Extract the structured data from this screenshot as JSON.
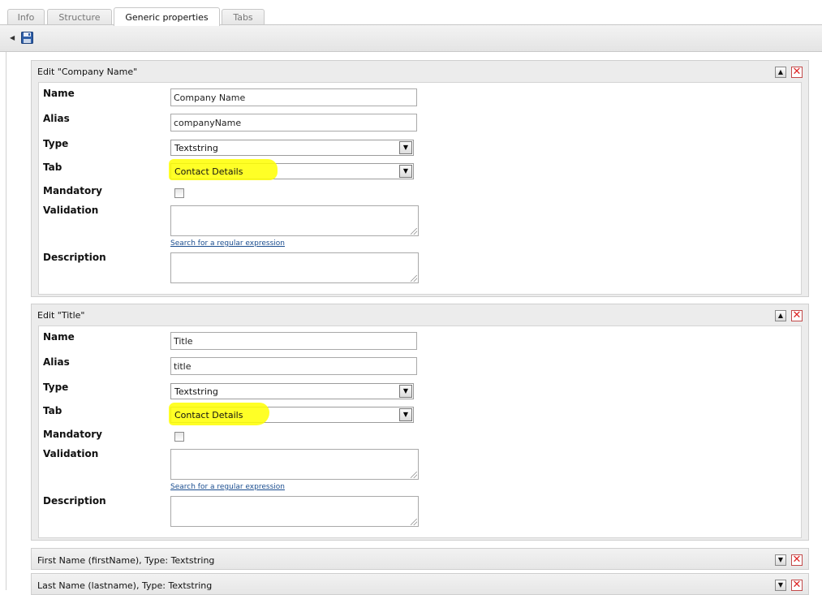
{
  "tabs": [
    {
      "label": "Info",
      "active": false
    },
    {
      "label": "Structure",
      "active": false
    },
    {
      "label": "Generic properties",
      "active": true
    },
    {
      "label": "Tabs",
      "active": false
    }
  ],
  "toolbar": {
    "collapse_icon": "triangle-left-icon",
    "save_icon": "floppy-disk-icon"
  },
  "labels": {
    "name": "Name",
    "alias": "Alias",
    "type": "Type",
    "tab": "Tab",
    "mandatory": "Mandatory",
    "validation": "Validation",
    "description": "Description",
    "regex_link": "Search for a regular expression"
  },
  "panels": [
    {
      "title": "Edit \"Company Name\"",
      "name": "Company Name",
      "alias": "companyName",
      "type": "Textstring",
      "tab": "Contact Details",
      "mandatory": false,
      "validation": "",
      "description": ""
    },
    {
      "title": "Edit \"Title\"",
      "name": "Title",
      "alias": "title",
      "type": "Textstring",
      "tab": "Contact Details",
      "mandatory": false,
      "validation": "",
      "description": ""
    }
  ],
  "collapsed": [
    {
      "title": "First Name (firstName), Type: Textstring"
    },
    {
      "title": "Last Name (lastname), Type: Textstring"
    }
  ],
  "colors": {
    "highlight": "#ffff00",
    "link": "#1a4d8f",
    "delete": "#d22222"
  }
}
